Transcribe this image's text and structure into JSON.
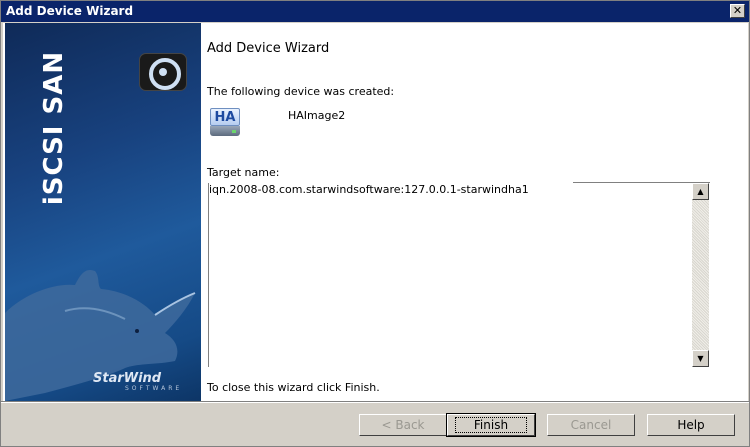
{
  "window": {
    "title": "Add Device Wizard"
  },
  "sidebar": {
    "brand_text": "iSCSI SAN",
    "logo_text": "StarWind",
    "logo_sub": "SOFTWARE"
  },
  "main": {
    "heading": "Add Device Wizard",
    "created_label": "The following device was created:",
    "device_icon_text": "HA",
    "device_name": "HAImage2",
    "target_label": "Target name:",
    "target_value": "iqn.2008-08.com.starwindsoftware:127.0.0.1-starwindha1",
    "close_hint": "To close this wizard click Finish."
  },
  "buttons": {
    "back": "< Back",
    "finish": "Finish",
    "cancel": "Cancel",
    "help": "Help"
  }
}
